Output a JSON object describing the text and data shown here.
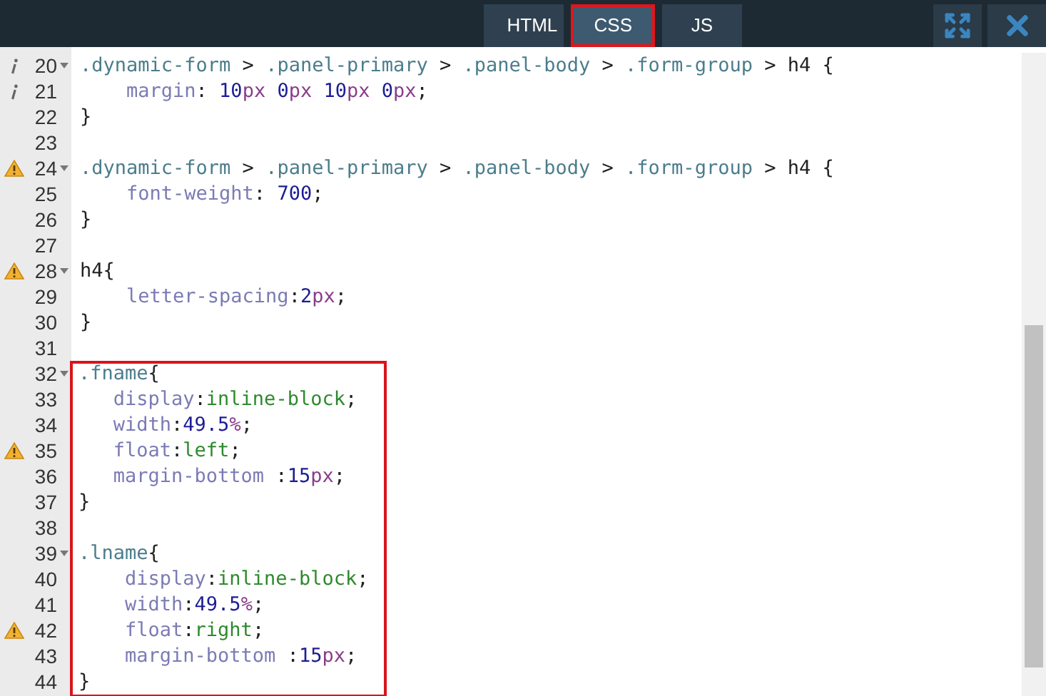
{
  "tabs": [
    {
      "label": "HTML",
      "selected": false
    },
    {
      "label": "CSS",
      "selected": true
    },
    {
      "label": "JS",
      "selected": false
    }
  ],
  "editor": {
    "blocks": [
      {
        "highlighted": false,
        "lines": [
          {
            "number": "20",
            "info": true,
            "warning": false,
            "foldable": true,
            "tokens": [
              {
                "kind": "selector",
                "text": ".dynamic-form"
              },
              {
                "kind": "punct",
                "text": " > "
              },
              {
                "kind": "selector",
                "text": ".panel-primary"
              },
              {
                "kind": "punct",
                "text": " > "
              },
              {
                "kind": "selector",
                "text": ".panel-body"
              },
              {
                "kind": "punct",
                "text": " > "
              },
              {
                "kind": "selector",
                "text": ".form-group"
              },
              {
                "kind": "punct",
                "text": " > "
              },
              {
                "kind": "tag",
                "text": "h4"
              },
              {
                "kind": "punct",
                "text": " {"
              }
            ]
          },
          {
            "number": "21",
            "info": true,
            "warning": false,
            "foldable": false,
            "tokens": [
              {
                "kind": "property",
                "text": "    margin"
              },
              {
                "kind": "punct",
                "text": ": "
              },
              {
                "kind": "number",
                "text": "10"
              },
              {
                "kind": "unit",
                "text": "px "
              },
              {
                "kind": "number",
                "text": "0"
              },
              {
                "kind": "unit",
                "text": "px "
              },
              {
                "kind": "number",
                "text": "10"
              },
              {
                "kind": "unit",
                "text": "px "
              },
              {
                "kind": "number",
                "text": "0"
              },
              {
                "kind": "unit",
                "text": "px"
              },
              {
                "kind": "punct",
                "text": ";"
              }
            ]
          },
          {
            "number": "22",
            "info": false,
            "warning": false,
            "foldable": false,
            "tokens": [
              {
                "kind": "punct",
                "text": "}"
              }
            ]
          },
          {
            "number": "23",
            "info": false,
            "warning": false,
            "foldable": false
          },
          {
            "number": "24",
            "info": false,
            "warning": true,
            "foldable": true,
            "tokens": [
              {
                "kind": "selector",
                "text": ".dynamic-form"
              },
              {
                "kind": "punct",
                "text": " > "
              },
              {
                "kind": "selector",
                "text": ".panel-primary"
              },
              {
                "kind": "punct",
                "text": " > "
              },
              {
                "kind": "selector",
                "text": ".panel-body"
              },
              {
                "kind": "punct",
                "text": " > "
              },
              {
                "kind": "selector",
                "text": ".form-group"
              },
              {
                "kind": "punct",
                "text": " > "
              },
              {
                "kind": "tag",
                "text": "h4"
              },
              {
                "kind": "punct",
                "text": " {"
              }
            ]
          },
          {
            "number": "25",
            "info": false,
            "warning": false,
            "foldable": false,
            "tokens": [
              {
                "kind": "property",
                "text": "    font-weight"
              },
              {
                "kind": "punct",
                "text": ": "
              },
              {
                "kind": "number",
                "text": "700"
              },
              {
                "kind": "punct",
                "text": ";"
              }
            ]
          },
          {
            "number": "26",
            "info": false,
            "warning": false,
            "foldable": false,
            "tokens": [
              {
                "kind": "punct",
                "text": "}"
              }
            ]
          },
          {
            "number": "27",
            "info": false,
            "warning": false,
            "foldable": false
          },
          {
            "number": "28",
            "info": false,
            "warning": true,
            "foldable": true,
            "tokens": [
              {
                "kind": "tag",
                "text": "h4"
              },
              {
                "kind": "punct",
                "text": "{"
              }
            ]
          },
          {
            "number": "29",
            "info": false,
            "warning": false,
            "foldable": false,
            "tokens": [
              {
                "kind": "property",
                "text": "    letter-spacing"
              },
              {
                "kind": "punct",
                "text": ":"
              },
              {
                "kind": "number",
                "text": "2"
              },
              {
                "kind": "unit",
                "text": "px"
              },
              {
                "kind": "punct",
                "text": ";"
              }
            ]
          },
          {
            "number": "30",
            "info": false,
            "warning": false,
            "foldable": false,
            "tokens": [
              {
                "kind": "punct",
                "text": "}"
              }
            ]
          },
          {
            "number": "31",
            "info": false,
            "warning": false,
            "foldable": false
          }
        ]
      },
      {
        "highlighted": true,
        "lines": [
          {
            "number": "32",
            "info": false,
            "warning": false,
            "foldable": true,
            "tokens": [
              {
                "kind": "selector",
                "text": ".fname"
              },
              {
                "kind": "punct",
                "text": "{"
              }
            ]
          },
          {
            "number": "33",
            "info": false,
            "warning": false,
            "foldable": false,
            "tokens": [
              {
                "kind": "property",
                "text": "   display"
              },
              {
                "kind": "punct",
                "text": ":"
              },
              {
                "kind": "keyword",
                "text": "inline-block"
              },
              {
                "kind": "punct",
                "text": ";"
              }
            ]
          },
          {
            "number": "34",
            "info": false,
            "warning": false,
            "foldable": false,
            "tokens": [
              {
                "kind": "property",
                "text": "   width"
              },
              {
                "kind": "punct",
                "text": ":"
              },
              {
                "kind": "number",
                "text": "49.5"
              },
              {
                "kind": "unit",
                "text": "%"
              },
              {
                "kind": "punct",
                "text": ";"
              }
            ]
          },
          {
            "number": "35",
            "info": false,
            "warning": true,
            "foldable": false,
            "tokens": [
              {
                "kind": "property",
                "text": "   float"
              },
              {
                "kind": "punct",
                "text": ":"
              },
              {
                "kind": "keyword",
                "text": "left"
              },
              {
                "kind": "punct",
                "text": ";"
              }
            ]
          },
          {
            "number": "36",
            "info": false,
            "warning": false,
            "foldable": false,
            "tokens": [
              {
                "kind": "property",
                "text": "   margin-bottom"
              },
              {
                "kind": "punct",
                "text": " :"
              },
              {
                "kind": "number",
                "text": "15"
              },
              {
                "kind": "unit",
                "text": "px"
              },
              {
                "kind": "punct",
                "text": ";"
              }
            ]
          },
          {
            "number": "37",
            "info": false,
            "warning": false,
            "foldable": false,
            "tokens": [
              {
                "kind": "punct",
                "text": "}"
              }
            ]
          },
          {
            "number": "38",
            "info": false,
            "warning": false,
            "foldable": false
          },
          {
            "number": "39",
            "info": false,
            "warning": false,
            "foldable": true,
            "tokens": [
              {
                "kind": "selector",
                "text": ".lname"
              },
              {
                "kind": "punct",
                "text": "{"
              }
            ]
          },
          {
            "number": "40",
            "info": false,
            "warning": false,
            "foldable": false,
            "tokens": [
              {
                "kind": "property",
                "text": "    display"
              },
              {
                "kind": "punct",
                "text": ":"
              },
              {
                "kind": "keyword",
                "text": "inline-block"
              },
              {
                "kind": "punct",
                "text": ";"
              }
            ]
          },
          {
            "number": "41",
            "info": false,
            "warning": false,
            "foldable": false,
            "tokens": [
              {
                "kind": "property",
                "text": "    width"
              },
              {
                "kind": "punct",
                "text": ":"
              },
              {
                "kind": "number",
                "text": "49.5"
              },
              {
                "kind": "unit",
                "text": "%"
              },
              {
                "kind": "punct",
                "text": ";"
              }
            ]
          },
          {
            "number": "42",
            "info": false,
            "warning": true,
            "foldable": false,
            "tokens": [
              {
                "kind": "property",
                "text": "    float"
              },
              {
                "kind": "punct",
                "text": ":"
              },
              {
                "kind": "keyword",
                "text": "right"
              },
              {
                "kind": "punct",
                "text": ";"
              }
            ]
          },
          {
            "number": "43",
            "info": false,
            "warning": false,
            "foldable": false,
            "tokens": [
              {
                "kind": "property",
                "text": "    margin-bottom"
              },
              {
                "kind": "punct",
                "text": " :"
              },
              {
                "kind": "number",
                "text": "15"
              },
              {
                "kind": "unit",
                "text": "px"
              },
              {
                "kind": "punct",
                "text": ";"
              }
            ]
          },
          {
            "number": "44",
            "info": false,
            "warning": false,
            "foldable": false,
            "tokens": [
              {
                "kind": "punct",
                "text": "}"
              }
            ]
          }
        ]
      }
    ]
  }
}
